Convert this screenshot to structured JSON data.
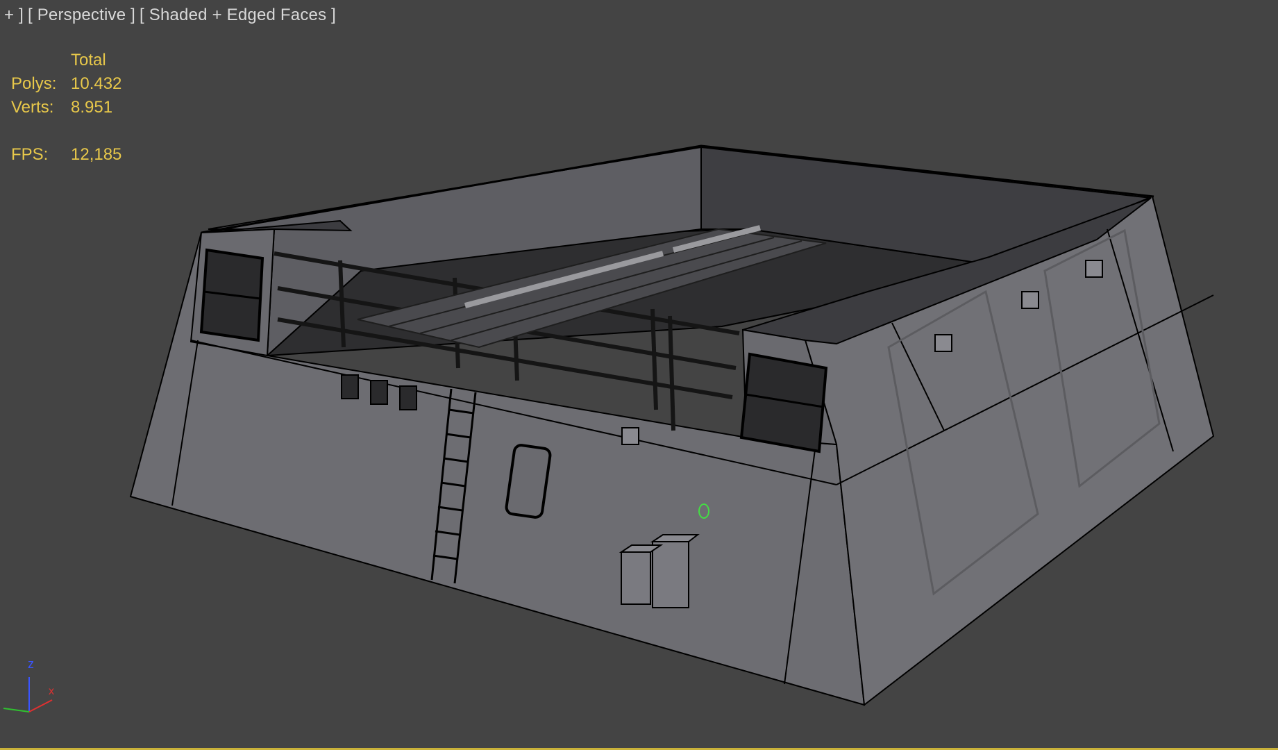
{
  "viewport": {
    "menu_label": "+ ]",
    "view_label": "[ Perspective ]",
    "shading_label": "[ Shaded + Edged Faces ]"
  },
  "stats": {
    "header": "Total",
    "polys_label": "Polys:",
    "polys_value": "10.432",
    "verts_label": "Verts:",
    "verts_value": "8.951",
    "fps_label": "FPS:",
    "fps_value": "12,185"
  },
  "axis": {
    "z": "z",
    "x": "x"
  },
  "colors": {
    "background": "#444444",
    "stats_text": "#e8c84a",
    "label_text": "#d8d8d8",
    "model_face": "#6f6f74",
    "model_face_dark": "#5a5a5f",
    "model_edge": "#000000",
    "axis_z": "#3a55ff",
    "axis_x": "#e03030",
    "axis_y": "#30c030",
    "pivot": "#44dd44"
  }
}
